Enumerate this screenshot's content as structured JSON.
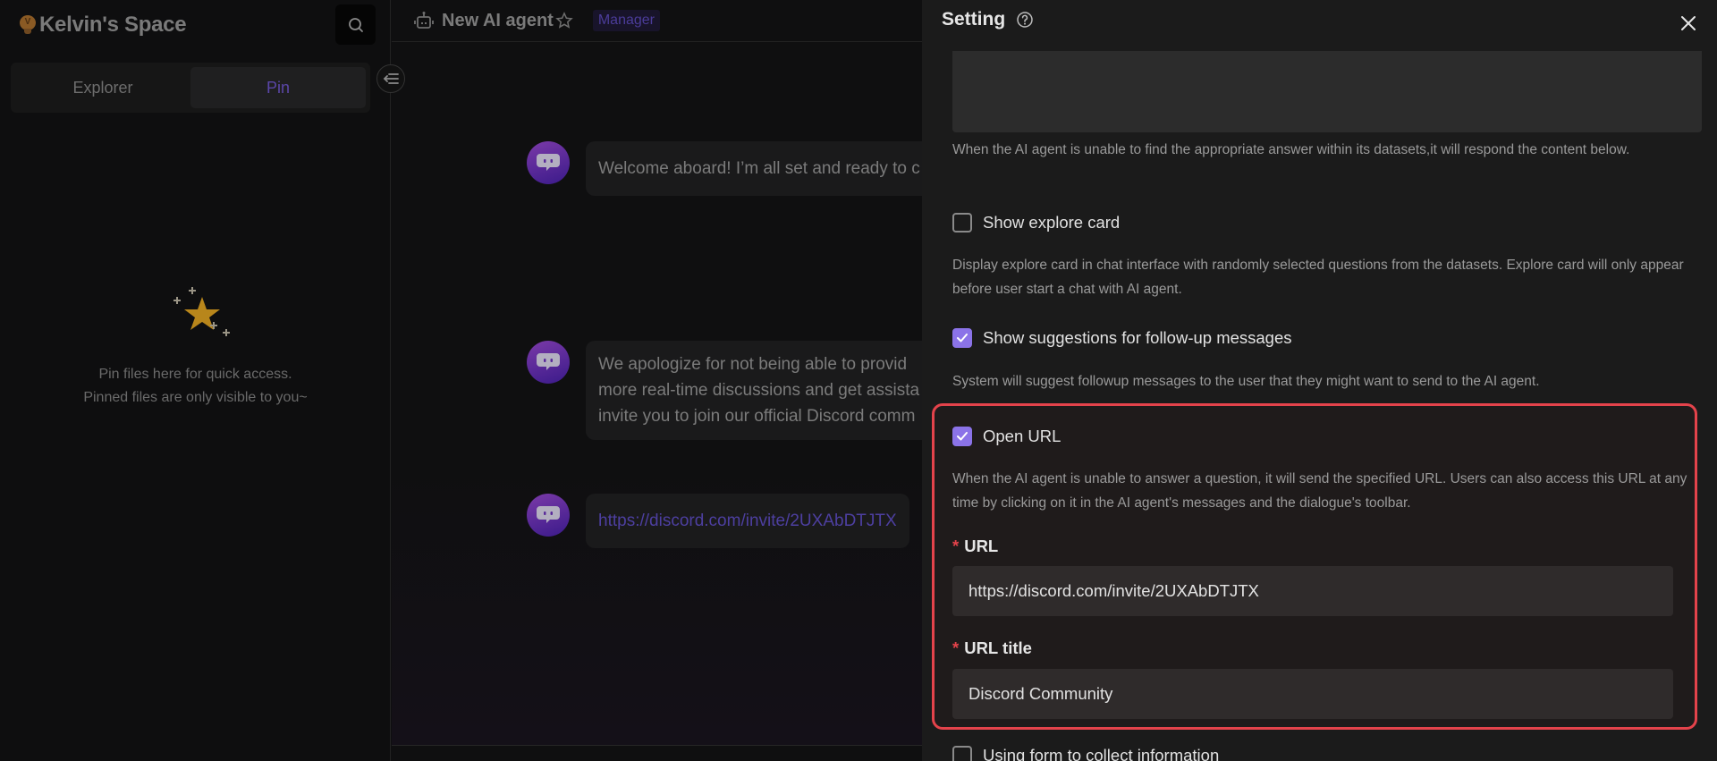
{
  "sidebar": {
    "title": "Kelvin's Space",
    "tabs": [
      {
        "label": "Explorer",
        "active": false
      },
      {
        "label": "Pin",
        "active": true
      }
    ],
    "empty_state": {
      "line1": "Pin files here for quick access.",
      "line2": "Pinned files are only visible to you~"
    }
  },
  "main": {
    "agent_name": "New AI agent",
    "role_badge": "Manager",
    "messages": [
      {
        "text": "Welcome aboard! I’m all set and ready to c",
        "type": "text"
      },
      {
        "lines": [
          "We apologize for not being able to provid",
          "more real-time discussions and get assista",
          "invite you to join our official Discord comm"
        ],
        "type": "text"
      },
      {
        "text": "https://discord.com/invite/2UXAbDTJTX",
        "type": "link"
      }
    ]
  },
  "setting": {
    "title": "Setting",
    "fallback_help": "When the AI agent is unable to find the appropriate answer within its datasets,it will respond the content below.",
    "options": [
      {
        "label": "Show explore card",
        "checked": false,
        "help": "Display explore card in chat interface with randomly selected questions from the datasets. Explore card will only appear before user start a chat with AI agent."
      },
      {
        "label": "Show suggestions for follow-up messages",
        "checked": true,
        "help": "System will suggest followup messages to the user that they might want to send to the AI agent."
      },
      {
        "label": "Open URL",
        "checked": true,
        "help": "When the AI agent is unable to answer a question, it will send the specified URL. Users can also access this URL at any time by clicking on it in the AI agent's messages and the dialogue's toolbar."
      },
      {
        "label": "Using form to collect information",
        "checked": false
      }
    ],
    "url_field": {
      "label": "URL",
      "required_mark": "*",
      "value": "https://discord.com/invite/2UXAbDTJTX"
    },
    "url_title_field": {
      "label": "URL title",
      "required_mark": "*",
      "value": "Discord Community"
    }
  },
  "colors": {
    "accent": "#8b73e8",
    "highlight_border": "#e4434b",
    "link": "#4d3fa0"
  }
}
